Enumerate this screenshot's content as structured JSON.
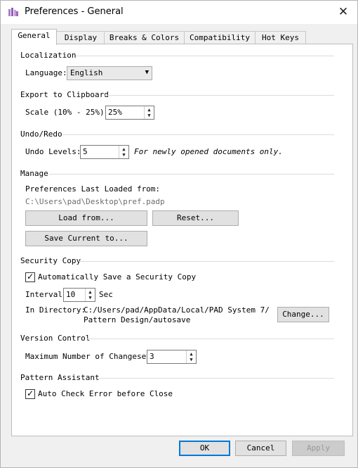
{
  "window": {
    "title": "Preferences - General",
    "close_glyph": "✕"
  },
  "tabs": [
    "General",
    "Display",
    "Breaks & Colors",
    "Compatibility",
    "Hot Keys"
  ],
  "localization": {
    "heading": "Localization",
    "language_label": "Language:",
    "language_value": "English"
  },
  "clipboard": {
    "heading": "Export to Clipboard",
    "scale_label": "Scale (10% - 25%):",
    "scale_value": "25%"
  },
  "undo": {
    "heading": "Undo/Redo",
    "levels_label": "Undo Levels:",
    "levels_value": "5",
    "note": "For newly opened documents only."
  },
  "manage": {
    "heading": "Manage",
    "loaded_label": "Preferences Last Loaded from:",
    "loaded_path": "C:\\Users\\pad\\Desktop\\pref.padp",
    "load_button": "Load from...",
    "reset_button": "Reset...",
    "save_button": "Save Current to..."
  },
  "security": {
    "heading": "Security Copy",
    "autosave_label": "Automatically Save a Security Copy",
    "autosave_checked": true,
    "interval_label": "Interval",
    "interval_value": "10",
    "interval_unit": "Sec",
    "dir_label": "In Directory:",
    "dir_line1": "C:/Users/pad/AppData/Local/PAD System 7/",
    "dir_line2": "Pattern Design/autosave",
    "change_button": "Change..."
  },
  "version": {
    "heading": "Version Control",
    "max_label": "Maximum Number of Changesets",
    "max_value": "3"
  },
  "assistant": {
    "heading": "Pattern Assistant",
    "autocheck_label": "Auto Check Error before Close",
    "autocheck_checked": true
  },
  "footer": {
    "ok": "OK",
    "cancel": "Cancel",
    "apply": "Apply"
  },
  "icons": {
    "check_glyph": "✓",
    "dropdown_arrow": "▼",
    "spin_up": "▲",
    "spin_down": "▼"
  }
}
